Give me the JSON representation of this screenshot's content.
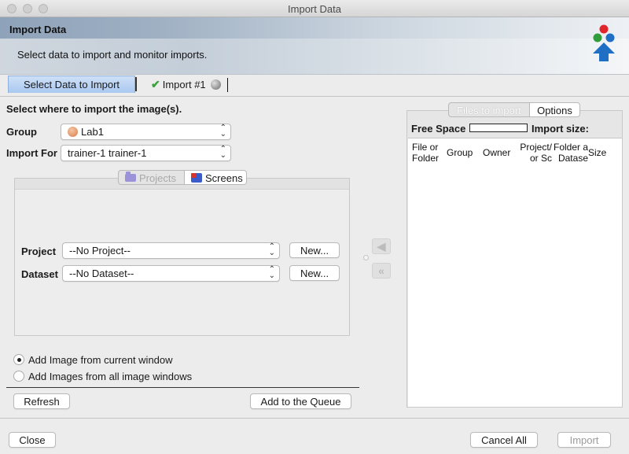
{
  "window": {
    "title": "Import Data"
  },
  "banner": {
    "title": "Import Data",
    "subtitle": "Select data to import and monitor imports."
  },
  "tabs": [
    {
      "label": "Select Data to Import"
    },
    {
      "label": "Import #1"
    }
  ],
  "left": {
    "heading": "Select where to import the image(s).",
    "group_label": "Group",
    "group_value": "Lab1",
    "import_for_label": "Import For",
    "import_for_value": "trainer-1 trainer-1",
    "segments": {
      "projects": "Projects",
      "screens": "Screens"
    },
    "project_label": "Project",
    "project_value": "--No Project--",
    "dataset_label": "Dataset",
    "dataset_value": "--No Dataset--",
    "new_label": "New...",
    "radio_current": "Add Image from current window",
    "radio_all": "Add Images from all image windows",
    "refresh": "Refresh",
    "add_queue": "Add to the Queue"
  },
  "right": {
    "segments": {
      "files": "Files to import",
      "options": "Options"
    },
    "free_space": "Free Space",
    "import_size": "Import size:",
    "columns": [
      {
        "line1": "File or",
        "line2": "Folder"
      },
      {
        "line1": "Group",
        "line2": ""
      },
      {
        "line1": "Owner",
        "line2": ""
      },
      {
        "line1": "Project/",
        "line2": "or Sc"
      },
      {
        "line1": "Folder a",
        "line2": "Datase"
      },
      {
        "line1": "Size",
        "line2": ""
      }
    ]
  },
  "footer": {
    "close": "Close",
    "cancel_all": "Cancel All",
    "import": "Import"
  },
  "colors": {
    "selected_tab": "#a9c8f0",
    "logo_red": "#e0262b",
    "logo_green": "#2e9d3a",
    "logo_blue": "#1f6fc4"
  }
}
